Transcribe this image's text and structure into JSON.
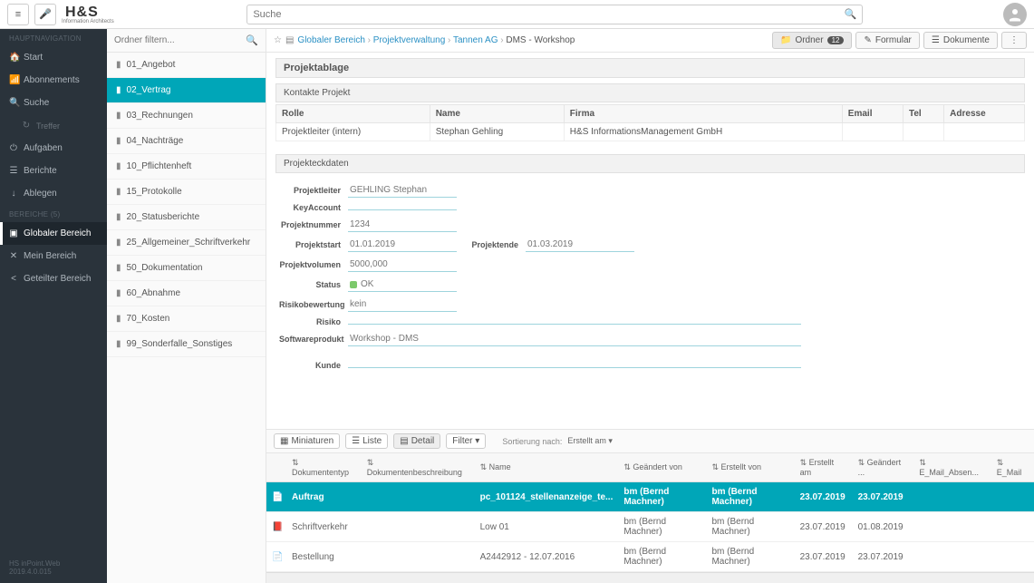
{
  "search": {
    "placeholder": "Suche"
  },
  "logo": {
    "main": "H&S",
    "sub": "Information Architects"
  },
  "sidenav": {
    "section1": "HAUPTNAVIGATION",
    "items1": [
      {
        "label": "Start",
        "icon": "🏠"
      },
      {
        "label": "Abonnements",
        "icon": "📶"
      },
      {
        "label": "Suche",
        "icon": "🔍"
      },
      {
        "label": "Treffer",
        "icon": "↻",
        "sub": true
      },
      {
        "label": "Aufgaben",
        "icon": "⏻"
      },
      {
        "label": "Berichte",
        "icon": "☰"
      },
      {
        "label": "Ablegen",
        "icon": "↓"
      }
    ],
    "section2": "BEREICHE (5)",
    "items2": [
      {
        "label": "Globaler Bereich",
        "icon": "▣",
        "active": true
      },
      {
        "label": "Mein Bereich",
        "icon": "✕"
      },
      {
        "label": "Geteilter Bereich",
        "icon": "<"
      }
    ],
    "footer": "HS  inPoint.Web 2019.4.0.015"
  },
  "folders": {
    "filter_placeholder": "Ordner filtern...",
    "items": [
      "01_Angebot",
      "02_Vertrag",
      "03_Rechnungen",
      "04_Nachträge",
      "10_Pflichtenheft",
      "15_Protokolle",
      "20_Statusberichte",
      "25_Allgemeiner_Schriftverkehr",
      "50_Dokumentation",
      "60_Abnahme",
      "70_Kosten",
      "99_Sonderfalle_Sonstiges"
    ],
    "active": "02_Vertrag"
  },
  "breadcrumb": {
    "items": [
      "Globaler Bereich",
      "Projektverwaltung",
      "Tannen AG",
      "DMS - Workshop"
    ]
  },
  "tabs": {
    "ordner": "Ordner",
    "ordner_count": "12",
    "formular": "Formular",
    "dokumente": "Dokumente",
    "menu": "⋮"
  },
  "panel": {
    "ablage": "Projektablage",
    "kontakte": "Kontakte Projekt",
    "contact_cols": {
      "rolle": "Rolle",
      "name": "Name",
      "firma": "Firma",
      "email": "Email",
      "tel": "Tel",
      "adresse": "Adresse"
    },
    "contact_row": {
      "rolle": "Projektleiter (intern)",
      "name": "Stephan Gehling",
      "firma": "H&S InformationsManagement GmbH",
      "email": "",
      "tel": "",
      "adresse": ""
    },
    "eck": "Projekteckdaten",
    "fields": {
      "projektleiter": {
        "lbl": "Projektleiter",
        "val": "GEHLING Stephan"
      },
      "keyaccount": {
        "lbl": "KeyAccount",
        "val": ""
      },
      "projektnummer": {
        "lbl": "Projektnummer",
        "val": "1234"
      },
      "projektstart": {
        "lbl": "Projektstart",
        "val": "01.01.2019"
      },
      "projektende": {
        "lbl": "Projektende",
        "val": "01.03.2019"
      },
      "projektvolumen": {
        "lbl": "Projektvolumen",
        "val": "5000,000"
      },
      "status": {
        "lbl": "Status",
        "val": "OK"
      },
      "risikobewertung": {
        "lbl": "Risikobewertung",
        "val": "kein"
      },
      "risiko": {
        "lbl": "Risiko",
        "val": ""
      },
      "softwareprodukt": {
        "lbl": "Softwareprodukt",
        "val": "Workshop - DMS"
      },
      "kunde": {
        "lbl": "Kunde",
        "val": ""
      }
    }
  },
  "docbar": {
    "miniaturen": "Miniaturen",
    "liste": "Liste",
    "detail": "Detail",
    "filter": "Filter ▾",
    "sort_label": "Sortierung nach:",
    "sort_value": "Erstellt am ▾"
  },
  "doccols": {
    "typ": "Dokumententyp",
    "beschr": "Dokumentenbeschreibung",
    "name": "Name",
    "geaendert_von": "Geändert von",
    "erstellt_von": "Erstellt von",
    "erstellt_am": "Erstellt am",
    "geaendert": "Geändert ...",
    "email_absen": "E_Mail_Absen...",
    "email": "E_Mail"
  },
  "docs": [
    {
      "sel": true,
      "typ": "Auftrag",
      "beschr": "",
      "name": "pc_101124_stellenanzeige_te...",
      "gv": "bm (Bernd Machner)",
      "ev": "bm (Bernd Machner)",
      "ea": "23.07.2019",
      "ga": "23.07.2019",
      "ico": "📄"
    },
    {
      "sel": false,
      "typ": "Schriftverkehr",
      "beschr": "",
      "name": "Low 01",
      "gv": "bm (Bernd Machner)",
      "ev": "bm (Bernd Machner)",
      "ea": "23.07.2019",
      "ga": "01.08.2019",
      "ico": "📕"
    },
    {
      "sel": false,
      "typ": "Bestellung",
      "beschr": "",
      "name": "A2442912 - 12.07.2016",
      "gv": "bm (Bernd Machner)",
      "ev": "bm (Bernd Machner)",
      "ea": "23.07.2019",
      "ga": "23.07.2019",
      "ico": "📄"
    }
  ]
}
